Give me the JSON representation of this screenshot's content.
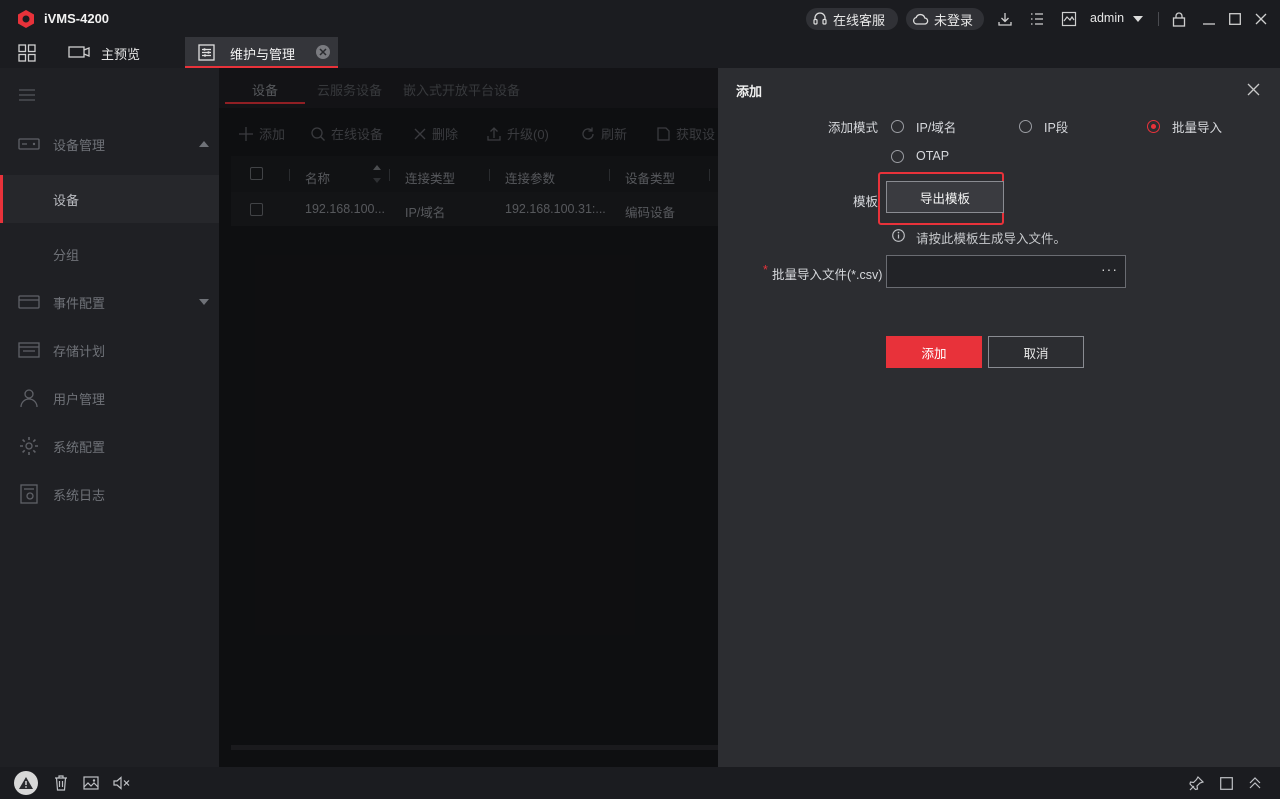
{
  "app": {
    "title": "iVMS-4200",
    "brand_color": "#e8323a"
  },
  "titlebar": {
    "online_service": "在线客服",
    "login_status": "未登录",
    "user": "admin"
  },
  "tabs": [
    {
      "label": "主预览",
      "icon": "camera-icon",
      "active": false
    },
    {
      "label": "维护与管理",
      "icon": "settings-panel-icon",
      "active": true
    }
  ],
  "sidebar": {
    "items": [
      {
        "label": "设备管理",
        "icon": "device-icon"
      },
      {
        "label": "设备",
        "active": true
      },
      {
        "label": "分组"
      },
      {
        "label": "事件配置",
        "icon": "event-icon"
      },
      {
        "label": "存储计划",
        "icon": "storage-icon"
      },
      {
        "label": "用户管理",
        "icon": "user-icon"
      },
      {
        "label": "系统配置",
        "icon": "gear-icon"
      },
      {
        "label": "系统日志",
        "icon": "log-icon"
      }
    ]
  },
  "main": {
    "subtabs": [
      "设备",
      "云服务设备",
      "嵌入式开放平台设备"
    ],
    "toolbar": {
      "add": "添加",
      "online": "在线设备",
      "delete": "删除",
      "upgrade": "升级(0)",
      "refresh": "刷新",
      "fetch": "获取设"
    },
    "table": {
      "headers": [
        "名称",
        "连接类型",
        "连接参数",
        "设备类型"
      ],
      "rows": [
        [
          "192.168.100...",
          "IP/域名",
          "192.168.100.31:...",
          "编码设备"
        ]
      ]
    }
  },
  "dialog": {
    "title": "添加",
    "mode_label": "添加模式",
    "modes": [
      "IP/域名",
      "IP段",
      "批量导入",
      "OTAP"
    ],
    "selected_mode": "批量导入",
    "template_label": "模板",
    "export_button": "导出模板",
    "hint": "请按此模板生成导入文件。",
    "file_label": "批量导入文件(*.csv)",
    "required_mark": "*",
    "browse": "···",
    "add_button": "添加",
    "cancel_button": "取消"
  }
}
